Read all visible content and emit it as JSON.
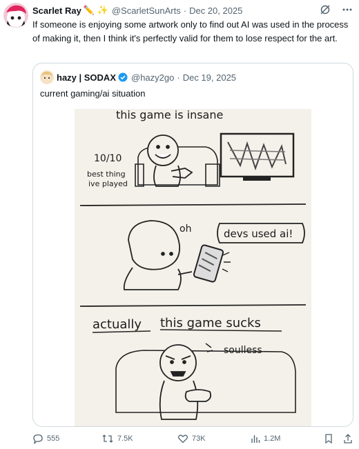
{
  "tweet": {
    "author_name": "Scarlet Ray",
    "author_emojis": "✏️ ✨",
    "handle": "@ScarletSunArts",
    "separator": "·",
    "date": "Dec 20, 2025",
    "text": "If someone is enjoying some artwork only to find out AI was used in the process of making it, then I think it's perfectly valid for them to lose respect for the art."
  },
  "quote": {
    "author_name": "hazy | SODAX",
    "handle": "@hazy2go",
    "separator": "·",
    "date": "Dec 19, 2025",
    "text": "current gaming/ai situation",
    "comic": {
      "panel1_caption": "this game is insane",
      "panel1_score": "10/10",
      "panel1_note_line1": "best thing",
      "panel1_note_line2": "ive played",
      "panel2_reaction": "oh",
      "panel2_bubble": "devs used ai!",
      "panel3_caption_a": "actually",
      "panel3_caption_b": "this game sucks",
      "panel3_note": "soulless"
    }
  },
  "actions": {
    "replies": "555",
    "reposts": "7.5K",
    "likes": "73K",
    "views": "1.2M"
  },
  "colors": {
    "text_primary": "#0f1419",
    "text_secondary": "#536471",
    "border": "#cfd9de",
    "verified_blue": "#1d9bf0",
    "comic_paper": "#f4f1ea"
  },
  "icons": [
    "grok-icon",
    "more-icon",
    "verified-icon",
    "reply-icon",
    "repost-icon",
    "like-icon",
    "views-icon",
    "bookmark-icon",
    "share-icon"
  ]
}
